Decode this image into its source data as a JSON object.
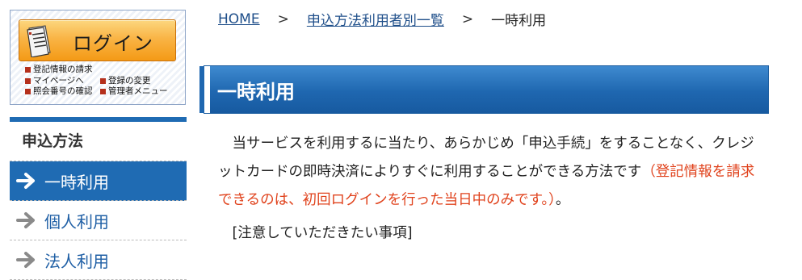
{
  "login": {
    "button_label": "ログイン",
    "links": [
      "登記情報の請求",
      "マイページへ",
      "登録の変更",
      "照会番号の確認",
      "管理者メニュー"
    ]
  },
  "sidebar": {
    "heading": "申込方法",
    "items": [
      {
        "label": "一時利用",
        "active": true
      },
      {
        "label": "個人利用",
        "active": false
      },
      {
        "label": "法人利用",
        "active": false
      }
    ]
  },
  "breadcrumb": {
    "home": "HOME",
    "separator": ">",
    "parent": "申込方法利用者別一覧",
    "current": "一時利用"
  },
  "page": {
    "title": "一時利用",
    "intro_text": "当サービスを利用するに当たり、あらかじめ「申込手続」をすることなく、クレジットカードの即時決済によりすぐに利用することができる方法です",
    "intro_note": "（登記情報を請求できるのは、初回ログインを行った当日中のみです。）",
    "intro_end": "。",
    "notice_heading": "[注意していただきたい事項]"
  },
  "colors": {
    "accent_blue": "#1f6bb3",
    "login_orange": "#f9b445",
    "note_red": "#e0421c",
    "link_blue": "#1f4f8a"
  },
  "icons": {
    "login": "document-icon",
    "bullet": "square-bullet-icon",
    "nav_arrow": "arrow-right-icon"
  }
}
